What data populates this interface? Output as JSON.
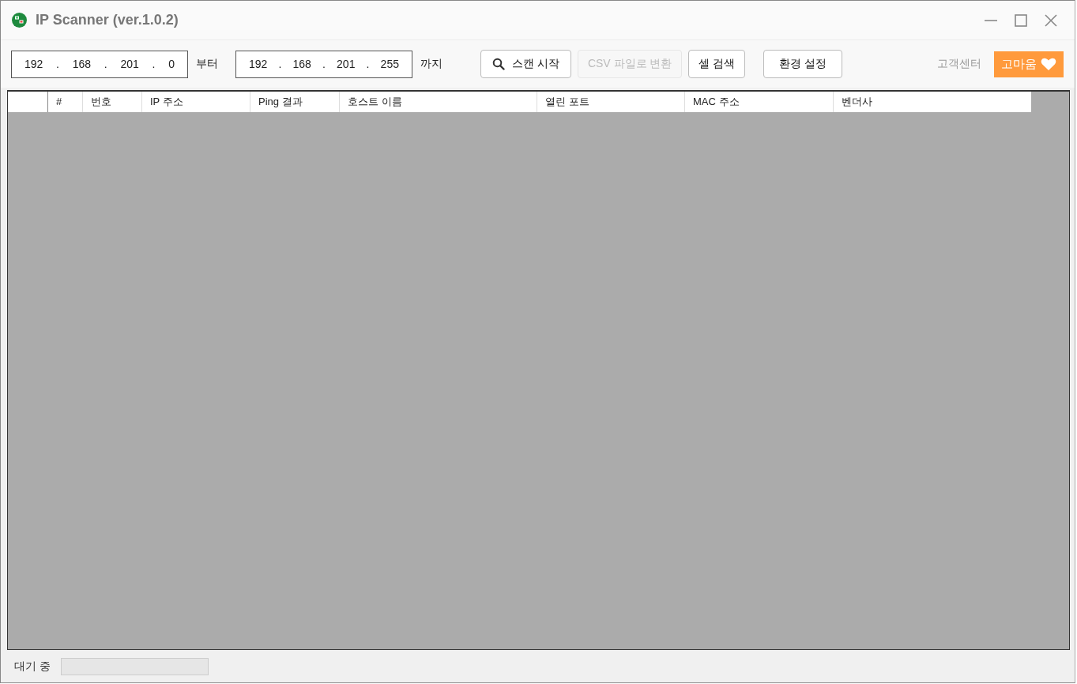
{
  "window": {
    "title": "IP Scanner (ver.1.0.2)"
  },
  "range": {
    "start": {
      "parts": [
        "192",
        ".",
        "168",
        ".",
        "201",
        ".",
        "0"
      ],
      "suffix": "부터"
    },
    "end": {
      "parts": [
        "192",
        ".",
        "168",
        ".",
        "201",
        ".",
        "255"
      ],
      "suffix": "까지"
    }
  },
  "buttons": [
    {
      "kind": "search",
      "label": "스캔 시작",
      "disabled": false
    },
    {
      "kind": "plain",
      "label": "CSV 파일로 변환",
      "disabled": true
    },
    {
      "kind": "plain",
      "label": "셀 검색",
      "disabled": false
    },
    {
      "kind": "wide",
      "label": "환경 설정",
      "disabled": false
    }
  ],
  "support_link": "고객센터",
  "thanks_button": {
    "label": "고마움"
  },
  "table": {
    "columns": [
      "",
      "#",
      "번호",
      "IP 주소",
      "Ping 결과",
      "호스트 이름",
      "열린 포트",
      "MAC 주소",
      "벤더사"
    ]
  },
  "status_bar": {
    "text": "대기 중",
    "progress": {
      "level": 0
    }
  }
}
